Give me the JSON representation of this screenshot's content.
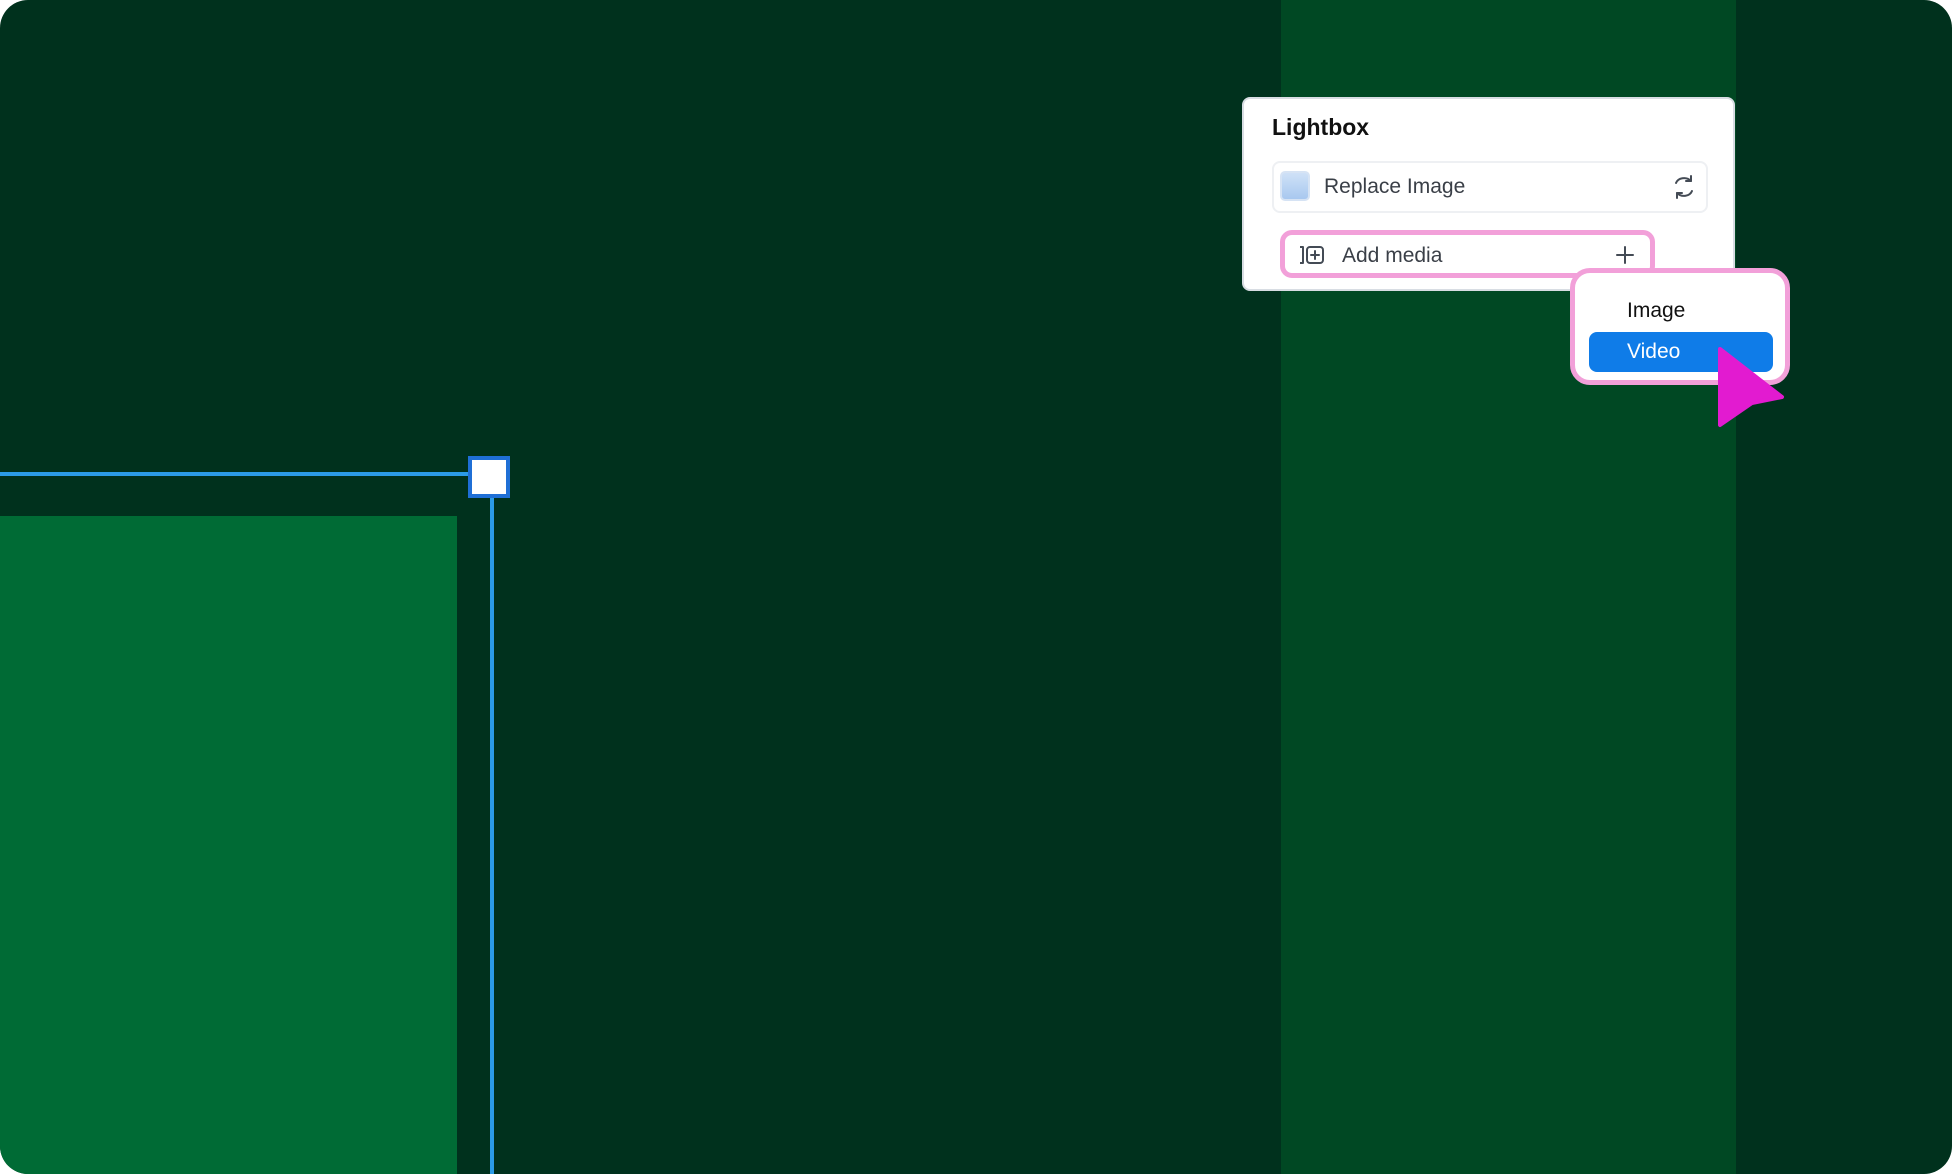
{
  "panel": {
    "title": "Lightbox",
    "replace_label": "Replace Image",
    "add_media_label": "Add media"
  },
  "dropdown": {
    "items": [
      {
        "label": "Image",
        "selected": false
      },
      {
        "label": "Video",
        "selected": true
      }
    ]
  },
  "icons": {
    "thumbnail": "image-thumbnail-icon",
    "replace": "swap-arrows-icon",
    "media": "add-media-icon",
    "add": "plus-icon",
    "cursor": "pointer-cursor-icon"
  },
  "colors": {
    "canvas_bg": "#00311d",
    "column_bg": "#004823",
    "block_bg": "#006b35",
    "selection": "#2b9be6",
    "highlight": "#f2a0d9",
    "selected_item": "#0f7ce8",
    "cursor": "#e21bd0"
  }
}
